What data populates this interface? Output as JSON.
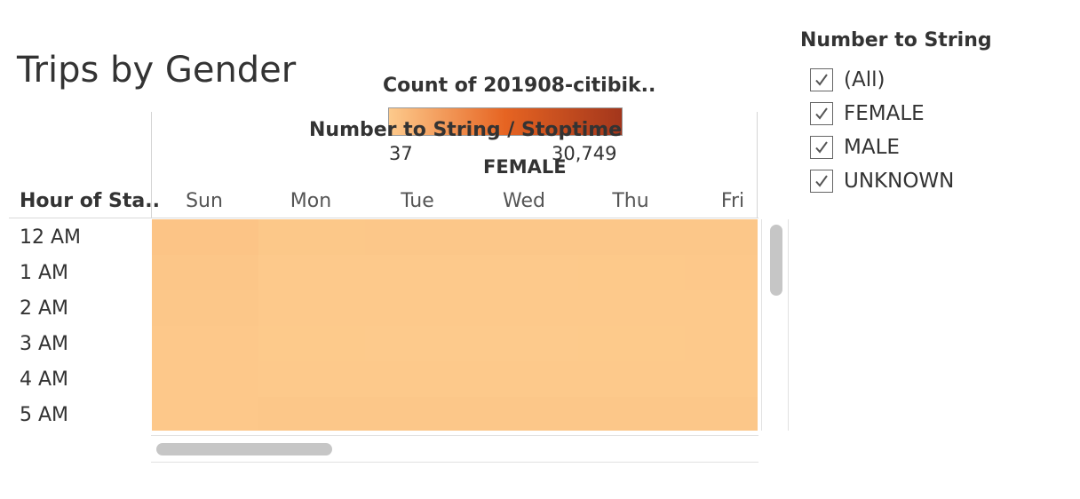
{
  "title": "Trips by Gender",
  "columns_title": "Number to String / Stoptime",
  "gender": "FEMALE",
  "row_header": "Hour of Sta..",
  "legend": {
    "title": "Count of 201908-citibik..",
    "min_label": "37",
    "max_label": "30,749",
    "color_low": "#fdca8c",
    "color_mid": "#e66422",
    "color_high": "#a3361c"
  },
  "filter": {
    "title": "Number to String",
    "items": [
      {
        "label": "(All)",
        "checked": true
      },
      {
        "label": "FEMALE",
        "checked": true
      },
      {
        "label": "MALE",
        "checked": true
      },
      {
        "label": "UNKNOWN",
        "checked": true
      }
    ]
  },
  "chart_data": {
    "type": "heatmap",
    "title": "Trips by Gender",
    "x_categories": [
      "Sun",
      "Mon",
      "Tue",
      "Wed",
      "Thu",
      "Fri"
    ],
    "y_categories": [
      "12 AM",
      "1 AM",
      "2 AM",
      "3 AM",
      "4 AM",
      "5 AM"
    ],
    "xlabel": "Number to String / Stoptime",
    "ylabel": "Hour of Sta..",
    "color_range": [
      37,
      30749
    ],
    "values": [
      [
        900,
        400,
        420,
        450,
        460,
        520
      ],
      [
        650,
        250,
        230,
        250,
        260,
        320
      ],
      [
        480,
        150,
        130,
        140,
        150,
        200
      ],
      [
        350,
        110,
        100,
        100,
        110,
        140
      ],
      [
        280,
        140,
        140,
        140,
        150,
        160
      ],
      [
        300,
        450,
        480,
        470,
        480,
        440
      ]
    ]
  }
}
